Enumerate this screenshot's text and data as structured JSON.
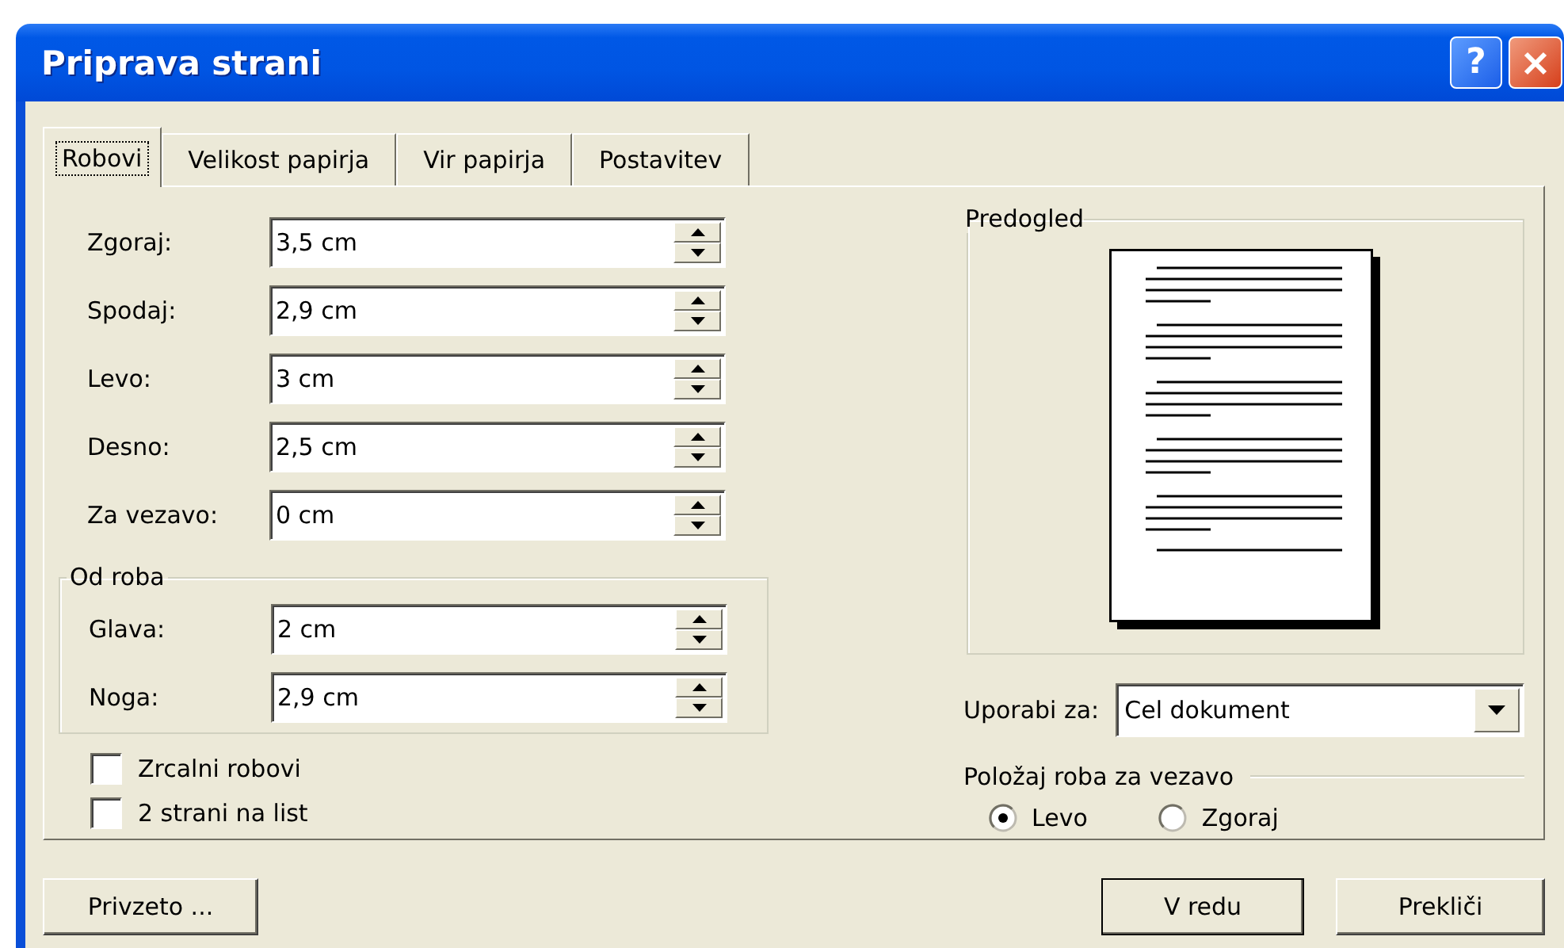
{
  "window": {
    "title": "Priprava strani",
    "help_button": "?"
  },
  "tabs": [
    {
      "label": "Robovi",
      "selected": true,
      "focused": true
    },
    {
      "label": "Velikost papirja",
      "selected": false,
      "focused": false
    },
    {
      "label": "Vir papirja",
      "selected": false,
      "focused": false
    },
    {
      "label": "Postavitev",
      "selected": false,
      "focused": false
    }
  ],
  "margins": [
    {
      "label": "Zgoraj:",
      "value": "3,5 cm"
    },
    {
      "label": "Spodaj:",
      "value": "2,9 cm"
    },
    {
      "label": "Levo:",
      "value": "3 cm"
    },
    {
      "label": "Desno:",
      "value": "2,5 cm"
    },
    {
      "label": "Za vezavo:",
      "value": "0 cm"
    }
  ],
  "from_edge": {
    "title": "Od roba",
    "fields": [
      {
        "label": "Glava:",
        "value": "2 cm"
      },
      {
        "label": "Noga:",
        "value": "2,9 cm"
      }
    ]
  },
  "options": [
    {
      "label": "Zrcalni robovi",
      "checked": false
    },
    {
      "label": "2 strani na list",
      "checked": false
    }
  ],
  "preview": {
    "title": "Predogled"
  },
  "apply_to": {
    "label": "Uporabi za:",
    "value": "Cel dokument"
  },
  "gutter_position": {
    "title": "Položaj roba za vezavo",
    "options": [
      {
        "label": "Levo",
        "selected": true
      },
      {
        "label": "Zgoraj",
        "selected": false
      }
    ]
  },
  "buttons": [
    {
      "label": "Privzeto ...",
      "default": false
    },
    {
      "label": "V redu",
      "default": true
    },
    {
      "label": "Prekliči",
      "default": false
    }
  ]
}
